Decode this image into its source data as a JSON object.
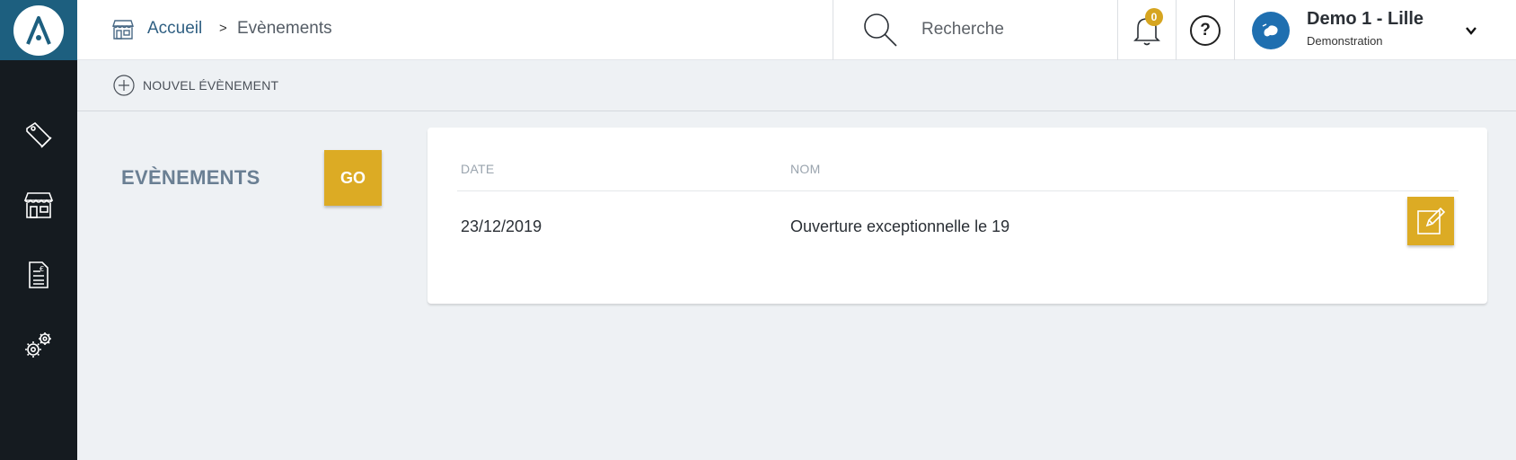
{
  "app": {
    "logo_icon": "app-logo-a-icon",
    "accent_color": "#dcab24",
    "sidebar_color": "#151b20"
  },
  "sidebar": {
    "items": [
      {
        "name": "sidebar-item-products",
        "icon": "tag-icon"
      },
      {
        "name": "sidebar-item-stores",
        "icon": "store-icon"
      },
      {
        "name": "sidebar-item-invoices",
        "icon": "invoice-icon"
      },
      {
        "name": "sidebar-item-settings",
        "icon": "gears-icon"
      }
    ]
  },
  "breadcrumb": {
    "home_label": "Accueil",
    "separator": ">",
    "current_label": "Evènements"
  },
  "search": {
    "placeholder": "Recherche"
  },
  "notifications": {
    "count": "0"
  },
  "help": {
    "label": "?"
  },
  "account": {
    "name": "Demo 1 - Lille",
    "subtitle": "Demonstration"
  },
  "toolbar": {
    "new_event_label": "NOUVEL ÉVÈNEMENT"
  },
  "main": {
    "section_title": "EVÈNEMENTS",
    "go_label": "GO"
  },
  "events_table": {
    "columns": {
      "date": "DATE",
      "name": "NOM"
    },
    "rows": [
      {
        "date": "23/12/2019",
        "name": "Ouverture exceptionnelle le 19"
      }
    ]
  }
}
